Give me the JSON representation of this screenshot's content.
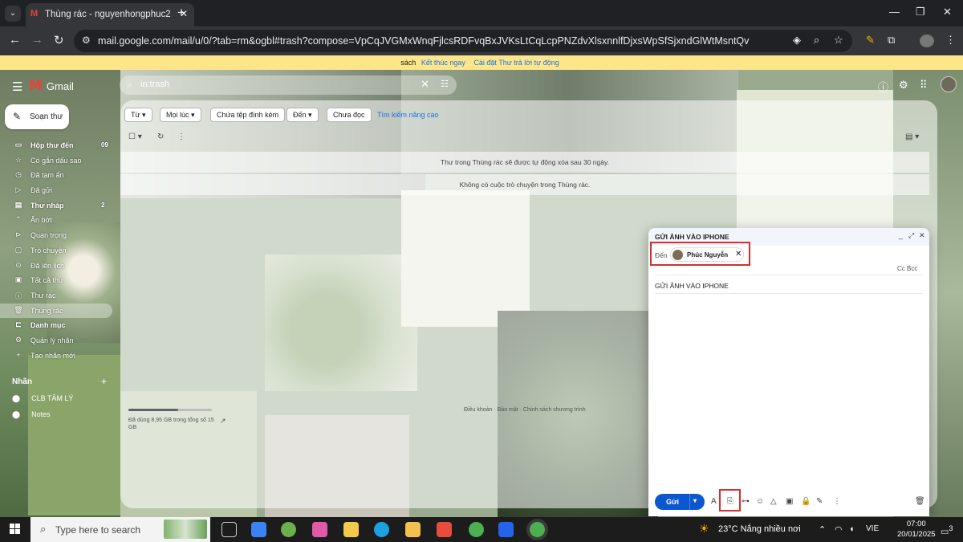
{
  "browser": {
    "tab_title": "Thùng rác - nguyenhongphuc2",
    "tab_close": "✕",
    "new_tab": "+",
    "url": "mail.google.com/mail/u/0/?tab=rm&ogbl#trash?compose=VpCqJVGMxWnqFjlcsRDFvqBxJVKsLtCqLcpPNZdvXlsxnnlfDjxsWpSfSjxndGlWtMsntQv"
  },
  "banner": {
    "prefix": "sách",
    "link1": "Kết thúc ngay",
    "link2": "Cài đặt Thư trả lời tự động"
  },
  "gmail": {
    "product": "Gmail",
    "search_query": "in:trash",
    "compose_label": "Soạn thư",
    "nav": [
      {
        "label": "Hộp thư đến",
        "count": "09",
        "icon": "inbox-icon",
        "glyph": "▭",
        "bold": true
      },
      {
        "label": "Có gắn dấu sao",
        "count": "",
        "icon": "star-icon",
        "glyph": "☆"
      },
      {
        "label": "Đã tạm ẩn",
        "count": "",
        "icon": "clock-icon",
        "glyph": "◷"
      },
      {
        "label": "Đã gửi",
        "count": "",
        "icon": "send-icon",
        "glyph": "▷"
      },
      {
        "label": "Thư nháp",
        "count": "2",
        "icon": "draft-icon",
        "glyph": "▤",
        "bold": true
      },
      {
        "label": "Ẩn bớt",
        "count": "",
        "icon": "chevron-up-icon",
        "glyph": "⌃"
      },
      {
        "label": "Quan trọng",
        "count": "",
        "icon": "important-icon",
        "glyph": "⊳"
      },
      {
        "label": "Trò chuyện",
        "count": "",
        "icon": "chat-icon",
        "glyph": "▢"
      },
      {
        "label": "Đã lên lịch",
        "count": "",
        "icon": "schedule-icon",
        "glyph": "⊙"
      },
      {
        "label": "Tất cả thư",
        "count": "",
        "icon": "all-mail-icon",
        "glyph": "▣"
      },
      {
        "label": "Thư rác",
        "count": "",
        "icon": "spam-icon",
        "glyph": "ⓘ"
      },
      {
        "label": "Thùng rác",
        "count": "",
        "icon": "trash-icon",
        "glyph": "🗑",
        "active": true
      },
      {
        "label": "Danh mục",
        "count": "",
        "icon": "category-icon",
        "glyph": "⊏",
        "bold": true
      },
      {
        "label": "Quản lý nhãn",
        "count": "",
        "icon": "gear-icon",
        "glyph": "⚙"
      },
      {
        "label": "Tạo nhãn mới",
        "count": "",
        "icon": "plus-icon",
        "glyph": "+"
      }
    ],
    "labels_heading": "Nhãn",
    "labels": [
      "CLB TÂM LÝ",
      "Notes"
    ],
    "filters": [
      "Từ",
      "Mọi lúc",
      "Chứa tệp đính kèm",
      "Đến",
      "Chưa đọc"
    ],
    "filters_with_dropdown": [
      true,
      true,
      false,
      true,
      false
    ],
    "advanced_search": "Tìm kiếm nâng cao",
    "trash_notice": "Thư trong Thùng rác sẽ được tự động xóa sau 30 ngày.",
    "empty_notice": "Không có cuộc trò chuyện trong Thùng rác.",
    "storage_text": "Đã dùng 8,95 GB trong tổng số 15 GB",
    "storage_fraction": 0.6,
    "footer": "Điều khoản · Bảo mật · Chính sách chương trình"
  },
  "compose": {
    "title": "GỬI ẢNH VÀO IPHONE",
    "to_label": "Đến",
    "recipient": "Phúc Nguyễn",
    "cc_bcc": "Cc Bcc",
    "subject": "GỬI ẢNH VÀO IPHONE",
    "send_label": "Gửi"
  },
  "taskbar": {
    "search_placeholder": "Type here to search",
    "weather": "23°C  Nắng nhiều nơi",
    "lang": "VIE",
    "time": "07:00",
    "date": "20/01/2025",
    "notifications": "3"
  }
}
